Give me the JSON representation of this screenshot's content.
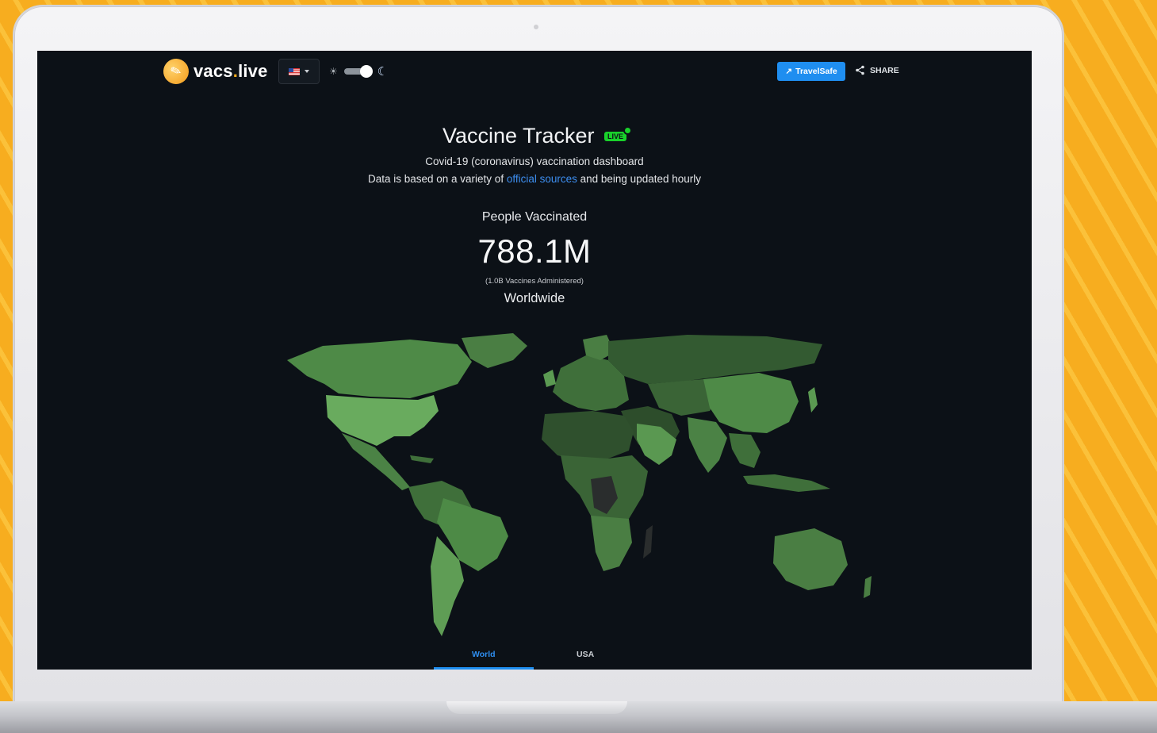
{
  "brand": {
    "name_prefix": "vacs",
    "name_dot": ".",
    "name_suffix": "live"
  },
  "nav": {
    "country_flag": "us-flag",
    "theme": "dark",
    "travelsafe_label": "TravelSafe",
    "share_label": "SHARE"
  },
  "hero": {
    "title": "Vaccine Tracker",
    "live_badge": "LIVE",
    "subtitle": "Covid-19 (coronavirus) vaccination dashboard",
    "source_prefix": "Data is based on a variety of ",
    "source_link": "official sources",
    "source_suffix": " and being updated hourly"
  },
  "stats": {
    "label": "People Vaccinated",
    "value": "788.1M",
    "sub": "(1.0B Vaccines Administered)",
    "region": "Worldwide"
  },
  "tabs": [
    {
      "label": "World",
      "active": true
    },
    {
      "label": "USA",
      "active": false
    }
  ],
  "colors": {
    "accent": "#1f8ef0",
    "live": "#19d22b",
    "brand": "#f7ad1f",
    "map_high": "#5b9a52",
    "map_mid": "#3f6f3a",
    "map_low": "#2c4a2a",
    "map_none": "#2a2d2d"
  },
  "icons": [
    "syringe-icon",
    "caret-down-icon",
    "sun-icon",
    "moon-icon",
    "syringe-small-icon",
    "share-icon"
  ]
}
